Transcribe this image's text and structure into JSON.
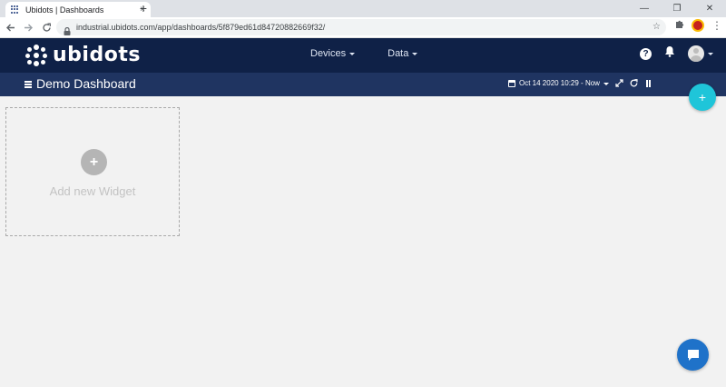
{
  "browser": {
    "tab_title": "Ubidots | Dashboards",
    "tab_close": "×",
    "new_tab": "+",
    "url": "industrial.ubidots.com/app/dashboards/5f879ed61d84720882669f32/",
    "win_minimize": "—",
    "win_restore": "❐",
    "win_close": "✕"
  },
  "app": {
    "logo_text": "ubidots",
    "nav": [
      {
        "label": "Devices"
      },
      {
        "label": "Data"
      }
    ],
    "help_label": "?"
  },
  "dashboard": {
    "title": "Demo Dashboard",
    "date_range": "Oct 14 2020 10:29 - Now",
    "fab_label": "+"
  },
  "widget_placeholder": {
    "plus": "+",
    "label": "Add new Widget"
  },
  "colors": {
    "appbar": "#0f2147",
    "dashbar": "#1f3461",
    "fab": "#1fc5d9",
    "chat": "#1f72c9"
  }
}
